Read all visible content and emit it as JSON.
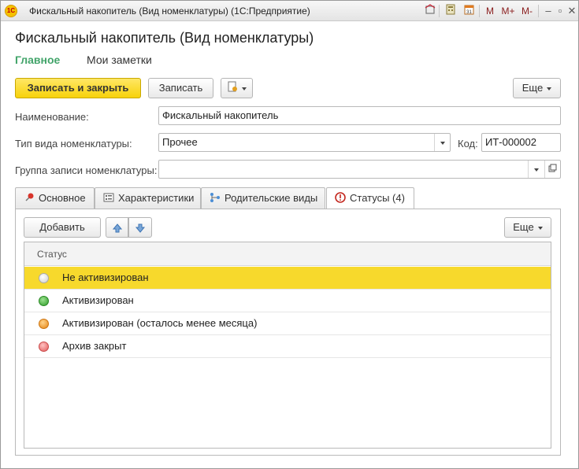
{
  "window": {
    "app_icon_text": "1С",
    "title": "Фискальный накопитель (Вид номенклатуры)  (1С:Предприятие)",
    "toolbar": {
      "m": "M",
      "m_plus": "M+",
      "m_minus": "M-",
      "minimize": "–",
      "restore": "▫",
      "close": "✕"
    }
  },
  "page": {
    "title": "Фискальный накопитель (Вид номенклатуры)",
    "nav": {
      "main": "Главное",
      "notes": "Мои заметки"
    }
  },
  "command_bar": {
    "save_close": "Записать и закрыть",
    "save": "Записать",
    "more": "Еще"
  },
  "form": {
    "name_label": "Наименование:",
    "name_value": "Фискальный накопитель",
    "type_label": "Тип вида номенклатуры:",
    "type_value": "Прочее",
    "code_label": "Код:",
    "code_value": "ИТ-000002",
    "group_label": "Группа записи номенклатуры:",
    "group_value": ""
  },
  "tabs": [
    {
      "label": "Основное"
    },
    {
      "label": "Характеристики"
    },
    {
      "label": "Родительские виды"
    },
    {
      "label": "Статусы (4)"
    }
  ],
  "statuses": {
    "add": "Добавить",
    "more": "Еще",
    "column_header": "Статус",
    "rows": [
      {
        "label": "Не активизирован",
        "color": "#f2f2f2",
        "selected": true
      },
      {
        "label": "Активизирован",
        "color": "#3aaa35",
        "selected": false
      },
      {
        "label": "Активизирован (осталось менее месяца)",
        "color": "#f59a2a",
        "selected": false
      },
      {
        "label": "Архив закрыт",
        "color": "#ef6f6f",
        "selected": false
      }
    ]
  },
  "colors": {
    "accent_green": "#42a46a",
    "primary_yellow": "#f7d20a",
    "selected_row": "#f7d92c"
  }
}
